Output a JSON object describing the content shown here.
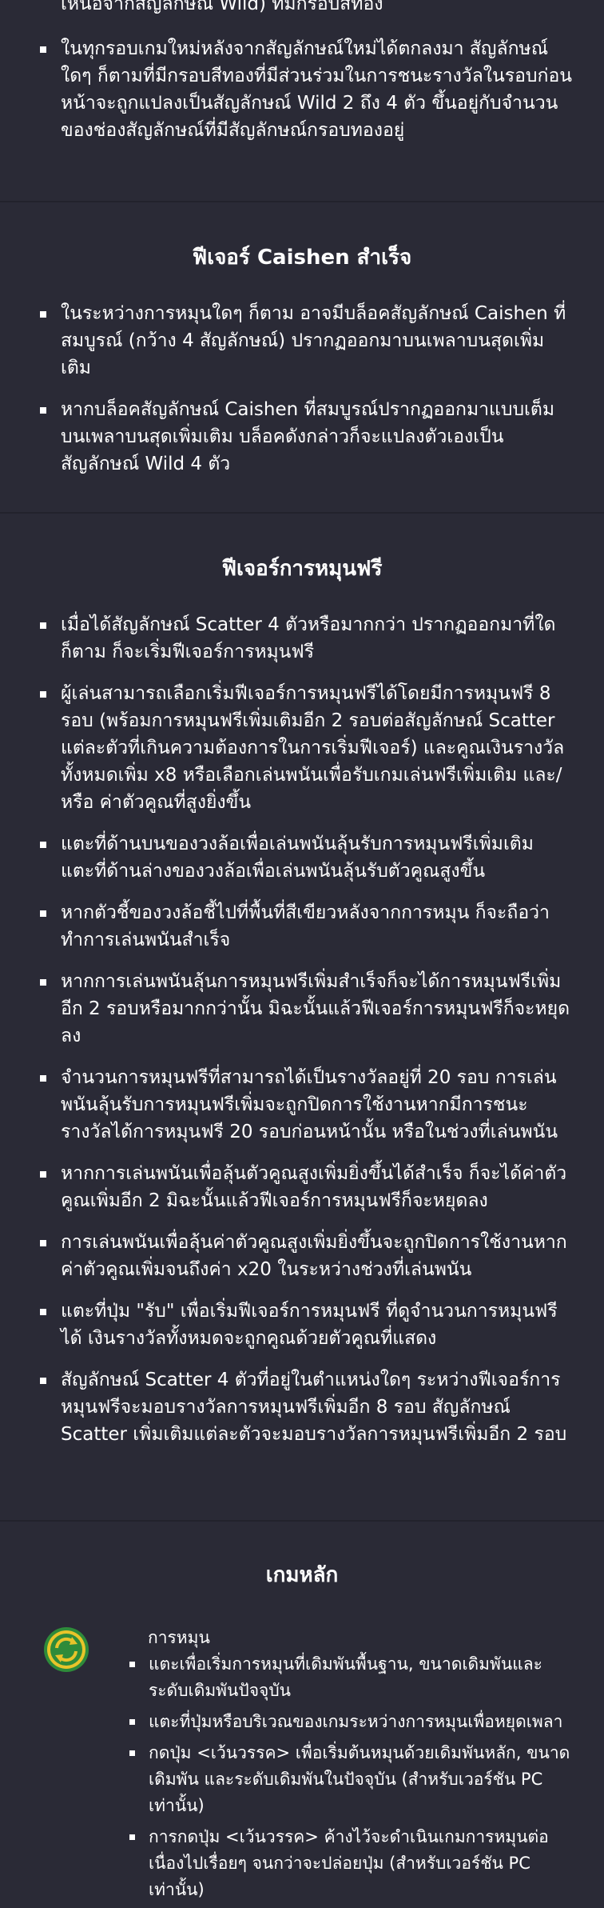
{
  "wild_section": {
    "top_fragment": "เหนือจากสัญลักษณ์ Wild) ที่มีกรอบสีทอง",
    "items": [
      "ในทุกรอบเกมใหม่หลังจากสัญลักษณ์ใหม่ได้ตกลงมา สัญลักษณ์ใดๆ ก็ตามที่มีกรอบสีทองที่มีส่วนร่วมในการชนะรางวัลในรอบก่อนหน้าจะถูกแปลงเป็นสัญลักษณ์ Wild 2 ถึง 4 ตัว ขึ้นอยู่กับจำนวนของช่องสัญลักษณ์ที่มีสัญลักษณ์กรอบทองอยู่"
    ]
  },
  "caishen_section": {
    "title": "ฟีเจอร์ Caishen สำเร็จ",
    "items": [
      "ในระหว่างการหมุนใดๆ ก็ตาม อาจมีบล็อคสัญลักษณ์ Caishen ที่สมบูรณ์ (กว้าง 4 สัญลักษณ์) ปรากฏออกมาบนเพลาบนสุดเพิ่มเติม",
      "หากบล็อคสัญลักษณ์ Caishen ที่สมบูรณ์ปรากฏออกมาแบบเต็มบนเพลาบนสุดเพิ่มเติม บล็อคดังกล่าวก็จะแปลงตัวเองเป็นสัญลักษณ์ Wild 4 ตัว"
    ]
  },
  "free_spin_section": {
    "title": "ฟีเจอร์การหมุนฟรี",
    "items": [
      "เมื่อได้สัญลักษณ์ Scatter 4 ตัวหรือมากกว่า ปรากฏออกมาที่ใดก็ตาม ก็จะเริ่มฟีเจอร์การหมุนฟรี",
      "ผู้เล่นสามารถเลือกเริ่มฟีเจอร์การหมุนฟรีได้โดยมีการหมุนฟรี 8 รอบ (พร้อมการหมุนฟรีเพิ่มเติมอีก 2 รอบต่อสัญลักษณ์ Scatter แต่ละตัวที่เกินความต้องการในการเริ่มฟีเจอร์) และคูณเงินรางวัลทั้งหมดเพิ่ม x8 หรือเลือกเล่นพนันเพื่อรับเกมเล่นฟรีเพิ่มเติม และ/หรือ ค่าตัวคูณที่สูงยิ่งขึ้น",
      "แตะที่ด้านบนของวงล้อเพื่อเล่นพนันลุ้นรับการหมุนฟรีเพิ่มเติม แตะที่ด้านล่างของวงล้อเพื่อเล่นพนันลุ้นรับตัวคูณสูงขึ้น",
      "หากตัวชี้ของวงล้อชี้ไปที่พื้นที่สีเขียวหลังจากการหมุน ก็จะถือว่าทำการเล่นพนันสำเร็จ",
      "หากการเล่นพนันลุ้นการหมุนฟรีเพิ่มสำเร็จก็จะได้การหมุนฟรีเพิ่มอีก 2 รอบหรือมากกว่านั้น มิฉะนั้นแล้วฟีเจอร์การหมุนฟรีก็จะหยุดลง",
      "จำนวนการหมุนฟรีที่สามารถได้เป็นรางวัลอยู่ที่ 20 รอบ การเล่นพนันลุ้นรับการหมุนฟรีเพิ่มจะถูกปิดการใช้งานหากมีการชนะรางวัลได้การหมุนฟรี 20 รอบก่อนหน้านั้น หรือในช่วงที่เล่นพนัน",
      "หากการเล่นพนันเพื่อลุ้นตัวคูณสูงเพิ่มยิ่งขึ้นได้สำเร็จ ก็จะได้ค่าตัวคูณเพิ่มอีก 2 มิฉะนั้นแล้วฟีเจอร์การหมุนฟรีก็จะหยุดลง",
      "การเล่นพนันเพื่อลุ้นค่าตัวคูณสูงเพิ่มยิ่งขึ้นจะถูกปิดการใช้งานหากค่าตัวคูณเพิ่มจนถึงค่า x20 ในระหว่างช่วงที่เล่นพนัน",
      "แตะที่ปุ่ม \"รับ\" เพื่อเริ่มฟีเจอร์การหมุนฟรี ที่ดูจำนวนการหมุนฟรีได้ เงินรางวัลทั้งหมดจะถูกคูณด้วยตัวคูณที่แสดง",
      "สัญลักษณ์ Scatter 4 ตัวที่อยู่ในตำแหน่งใดๆ ระหว่างฟีเจอร์การหมุนฟรีจะมอบรางวัลการหมุนฟรีเพิ่มอีก 8 รอบ สัญลักษณ์ Scatter เพิ่มเติมแต่ละตัวจะมอบรางวัลการหมุนฟรีเพิ่มอีก 2 รอบ"
    ]
  },
  "main_game_section": {
    "title": "เกมหลัก",
    "icon": "spin-icon",
    "spin_label": "การหมุน",
    "items": [
      "แตะเพื่อเริ่มการหมุนที่เดิมพันพื้นฐาน, ขนาดเดิมพันและระดับเดิมพันปัจจุบัน",
      "แตะที่ปุ่มหรือบริเวณของเกมระหว่างการหมุนเพื่อหยุดเพลา",
      "กดปุ่ม <เว้นวรรค> เพื่อเริ่มต้นหมุนด้วยเดิมพันหลัก, ขนาดเดิมพัน และระดับเดิมพันในปัจจุบัน (สำหรับเวอร์ชัน PC เท่านั้น)",
      "การกดปุ่ม <เว้นวรรค> ค้างไว้จะดำเนินเกมการหมุนต่อเนื่องไปเรื่อยๆ จนกว่าจะปล่อยปุ่ม (สำหรับเวอร์ชัน PC เท่านั้น)"
    ]
  },
  "colors": {
    "background": "#2a2a36",
    "separator": "#22222c",
    "text": "#ffffff",
    "icon_green": "#2e8b3a",
    "icon_yellow": "#e8c42a"
  }
}
